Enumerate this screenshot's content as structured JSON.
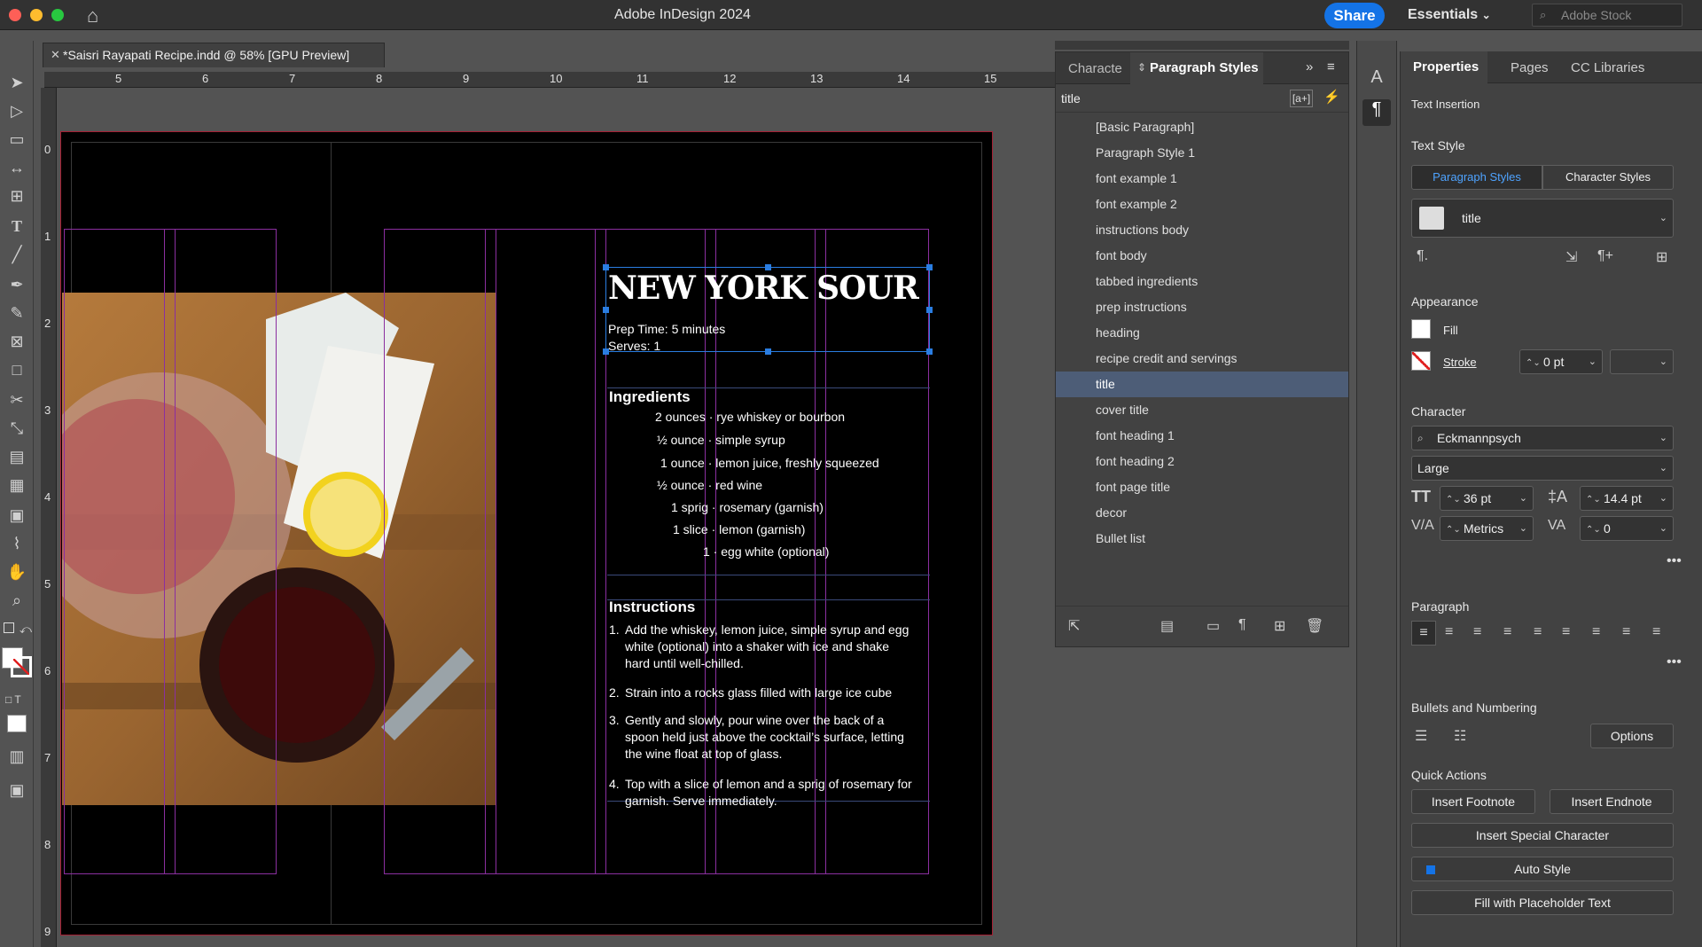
{
  "titlebar": {
    "app_title": "Adobe InDesign 2024",
    "share": "Share",
    "workspace": "Essentials",
    "stock_placeholder": "Adobe Stock"
  },
  "document": {
    "tab_title": "*Saisri Rayapati Recipe.indd @ 58% [GPU Preview]"
  },
  "rulers": {
    "h": [
      "5",
      "6",
      "7",
      "8",
      "9",
      "10",
      "11",
      "12",
      "13",
      "14",
      "15"
    ],
    "v": [
      "0",
      "1",
      "2",
      "3",
      "4",
      "5",
      "6",
      "7",
      "8",
      "9"
    ]
  },
  "recipe": {
    "title": "NEW YORK SOUR",
    "prep": "Prep Time: 5 minutes",
    "serves": "Serves: 1",
    "ingredients_heading": "Ingredients",
    "ingredients": [
      {
        "qty": "2 ounces",
        "item": "rye whiskey or bourbon"
      },
      {
        "qty": "½ ounce",
        "item": "simple syrup"
      },
      {
        "qty": "1 ounce",
        "item": "lemon juice, freshly squeezed"
      },
      {
        "qty": "½ ounce",
        "item": "red wine"
      },
      {
        "qty": "1 sprig",
        "item": "rosemary (garnish)"
      },
      {
        "qty": "1 slice",
        "item": "lemon (garnish)"
      },
      {
        "qty": "1",
        "item": "egg white (optional)"
      }
    ],
    "instructions_heading": "Instructions",
    "instructions": [
      {
        "num": "1.",
        "lines": [
          "Add the whiskey, lemon juice, simple syrup and egg",
          "white (optional) into a shaker with ice and shake",
          "hard until well-chilled."
        ]
      },
      {
        "num": "2.",
        "lines": [
          "Strain into a rocks glass filled with large ice cube"
        ]
      },
      {
        "num": "3.",
        "lines": [
          "Gently and slowly, pour wine over the back of a",
          "spoon held just above the cocktail’s surface, letting",
          "the wine float at top of glass."
        ]
      },
      {
        "num": "4.",
        "lines": [
          "Top with a slice of lemon and a sprig of rosemary for",
          "garnish. Serve immediately."
        ]
      }
    ]
  },
  "paragraph_styles_panel": {
    "tab_character": "Characte",
    "tab_paragraph": "Paragraph Styles",
    "search_value": "title",
    "styles": [
      "[Basic Paragraph]",
      "Paragraph Style 1",
      "font example 1",
      "font example 2",
      "instructions body",
      "font body",
      "tabbed ingredients",
      "prep instructions",
      "heading",
      "recipe credit and servings",
      "title",
      "cover title",
      "font heading 1",
      "font heading 2",
      "font page title",
      "decor",
      "Bullet list"
    ],
    "selected": "title"
  },
  "properties": {
    "tabs": [
      "Properties",
      "Pages",
      "CC Libraries"
    ],
    "text_insertion": "Text Insertion",
    "text_style": "Text Style",
    "style_tabs": [
      "Paragraph Styles",
      "Character Styles"
    ],
    "current_style": "title",
    "appearance": "Appearance",
    "fill": "Fill",
    "stroke": "Stroke",
    "stroke_weight": "0 pt",
    "character": "Character",
    "font": "Eckmannpsych",
    "font_style": "Large",
    "font_size": "36 pt",
    "leading": "14.4 pt",
    "kerning": "Metrics",
    "tracking": "0",
    "paragraph": "Paragraph",
    "bullets": "Bullets and Numbering",
    "options": "Options",
    "quick_actions": "Quick Actions",
    "insert_footnote": "Insert Footnote",
    "insert_endnote": "Insert Endnote",
    "insert_special": "Insert Special Character",
    "auto_style": "Auto Style",
    "fill_placeholder": "Fill with Placeholder Text"
  },
  "colors": {
    "accent": "#1473e6",
    "selection": "#4d5d77",
    "guide": "#8b2fa0",
    "frame": "#2a7de1"
  }
}
